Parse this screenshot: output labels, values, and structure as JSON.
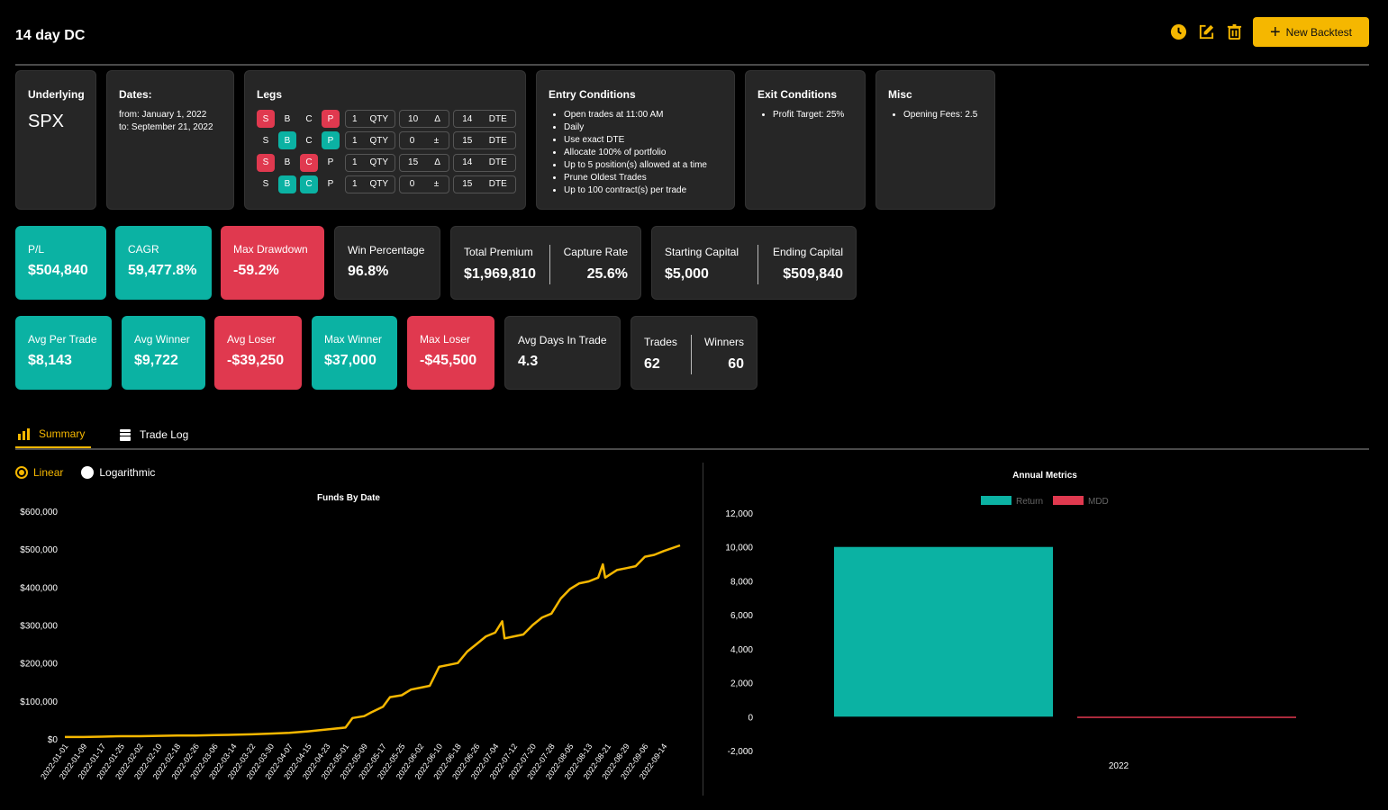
{
  "header": {
    "title": "14 day DC",
    "new_backtest_label": "New Backtest"
  },
  "config": {
    "underlying": {
      "title": "Underlying",
      "value": "SPX"
    },
    "dates": {
      "title": "Dates:",
      "from": "from: January 1, 2022",
      "to": "to: September 21, 2022"
    },
    "legs": {
      "title": "Legs",
      "rows": [
        {
          "s": "S",
          "b": "B",
          "c": "C",
          "p": "P",
          "active": [
            "s",
            "p"
          ],
          "qty": "1",
          "qty_unit": "QTY",
          "delta": "10",
          "delta_sym": "Δ",
          "dte": "14",
          "dte_unit": "DTE"
        },
        {
          "s": "S",
          "b": "B",
          "c": "C",
          "p": "P",
          "active": [
            "b",
            "p"
          ],
          "qty": "1",
          "qty_unit": "QTY",
          "delta": "0",
          "delta_sym": "±",
          "dte": "15",
          "dte_unit": "DTE"
        },
        {
          "s": "S",
          "b": "B",
          "c": "C",
          "p": "P",
          "active": [
            "s",
            "c"
          ],
          "qty": "1",
          "qty_unit": "QTY",
          "delta": "15",
          "delta_sym": "Δ",
          "dte": "14",
          "dte_unit": "DTE"
        },
        {
          "s": "S",
          "b": "B",
          "c": "C",
          "p": "P",
          "active": [
            "b",
            "c"
          ],
          "qty": "1",
          "qty_unit": "QTY",
          "delta": "0",
          "delta_sym": "±",
          "dte": "15",
          "dte_unit": "DTE"
        }
      ]
    },
    "entry": {
      "title": "Entry Conditions",
      "items": [
        "Open trades at 11:00 AM",
        "Daily",
        "Use exact DTE",
        "Allocate 100% of portfolio",
        "Up to 5 position(s) allowed at a time",
        "Prune Oldest Trades",
        "Up to 100 contract(s) per trade"
      ]
    },
    "exit": {
      "title": "Exit Conditions",
      "items": [
        "Profit Target: 25%"
      ]
    },
    "misc": {
      "title": "Misc",
      "items": [
        "Opening Fees: 2.5"
      ]
    }
  },
  "stats_row1": {
    "pl": {
      "label": "P/L",
      "value": "$504,840"
    },
    "cagr": {
      "label": "CAGR",
      "value": "59,477.8%"
    },
    "max_drawdown": {
      "label": "Max Drawdown",
      "value": "-59.2%"
    },
    "win_pct": {
      "label": "Win Percentage",
      "value": "96.8%"
    },
    "total_premium": {
      "label": "Total Premium",
      "value": "$1,969,810"
    },
    "capture_rate": {
      "label": "Capture Rate",
      "value": "25.6%"
    },
    "starting_capital": {
      "label": "Starting Capital",
      "value": "$5,000"
    },
    "ending_capital": {
      "label": "Ending Capital",
      "value": "$509,840"
    }
  },
  "stats_row2": {
    "avg_per_trade": {
      "label": "Avg Per Trade",
      "value": "$8,143"
    },
    "avg_winner": {
      "label": "Avg Winner",
      "value": "$9,722"
    },
    "avg_loser": {
      "label": "Avg Loser",
      "value": "-$39,250"
    },
    "max_winner": {
      "label": "Max Winner",
      "value": "$37,000"
    },
    "max_loser": {
      "label": "Max Loser",
      "value": "-$45,500"
    },
    "avg_days": {
      "label": "Avg Days In Trade",
      "value": "4.3"
    },
    "trades": {
      "label": "Trades",
      "value": "62"
    },
    "winners": {
      "label": "Winners",
      "value": "60"
    }
  },
  "tabs": [
    {
      "label": "Summary",
      "active": true
    },
    {
      "label": "Trade Log",
      "active": false
    }
  ],
  "scale": {
    "linear": "Linear",
    "log": "Logarithmic",
    "selected": "linear"
  },
  "colors": {
    "accent": "#f5b700",
    "teal": "#0bb2a3",
    "red": "#e0394f",
    "card": "#262626"
  },
  "chart_data": [
    {
      "type": "line",
      "title": "Funds By Date",
      "y_ticks": [
        "$0",
        "$100,000",
        "$200,000",
        "$300,000",
        "$400,000",
        "$500,000",
        "$600,000"
      ],
      "ylim": [
        0,
        600000
      ],
      "x_ticks": [
        "2022-01-01",
        "2022-01-09",
        "2022-01-17",
        "2022-01-25",
        "2022-02-02",
        "2022-02-10",
        "2022-02-18",
        "2022-02-26",
        "2022-03-06",
        "2022-03-14",
        "2022-03-22",
        "2022-03-30",
        "2022-04-07",
        "2022-04-15",
        "2022-04-23",
        "2022-05-01",
        "2022-05-09",
        "2022-05-17",
        "2022-05-25",
        "2022-06-02",
        "2022-06-10",
        "2022-06-18",
        "2022-06-26",
        "2022-07-04",
        "2022-07-12",
        "2022-07-20",
        "2022-07-28",
        "2022-08-05",
        "2022-08-13",
        "2022-08-21",
        "2022-08-29",
        "2022-09-06",
        "2022-09-14"
      ],
      "series": [
        {
          "color": "#f5b700",
          "points": [
            [
              "2022-01-01",
              5000
            ],
            [
              "2022-01-09",
              5000
            ],
            [
              "2022-01-17",
              6000
            ],
            [
              "2022-01-25",
              7000
            ],
            [
              "2022-02-02",
              7000
            ],
            [
              "2022-02-10",
              8000
            ],
            [
              "2022-02-18",
              9000
            ],
            [
              "2022-02-26",
              9000
            ],
            [
              "2022-03-06",
              10000
            ],
            [
              "2022-03-14",
              11000
            ],
            [
              "2022-03-22",
              12000
            ],
            [
              "2022-03-30",
              14000
            ],
            [
              "2022-04-07",
              16000
            ],
            [
              "2022-04-15",
              20000
            ],
            [
              "2022-04-23",
              25000
            ],
            [
              "2022-05-01",
              30000
            ],
            [
              "2022-05-04",
              55000
            ],
            [
              "2022-05-09",
              60000
            ],
            [
              "2022-05-12",
              70000
            ],
            [
              "2022-05-17",
              85000
            ],
            [
              "2022-05-20",
              110000
            ],
            [
              "2022-05-25",
              115000
            ],
            [
              "2022-05-29",
              130000
            ],
            [
              "2022-06-02",
              135000
            ],
            [
              "2022-06-06",
              140000
            ],
            [
              "2022-06-10",
              190000
            ],
            [
              "2022-06-14",
              195000
            ],
            [
              "2022-06-18",
              200000
            ],
            [
              "2022-06-22",
              230000
            ],
            [
              "2022-06-26",
              250000
            ],
            [
              "2022-06-30",
              270000
            ],
            [
              "2022-07-04",
              280000
            ],
            [
              "2022-07-07",
              310000
            ],
            [
              "2022-07-08",
              265000
            ],
            [
              "2022-07-12",
              270000
            ],
            [
              "2022-07-16",
              275000
            ],
            [
              "2022-07-20",
              300000
            ],
            [
              "2022-07-24",
              320000
            ],
            [
              "2022-07-28",
              330000
            ],
            [
              "2022-08-01",
              370000
            ],
            [
              "2022-08-05",
              395000
            ],
            [
              "2022-08-09",
              410000
            ],
            [
              "2022-08-13",
              415000
            ],
            [
              "2022-08-17",
              425000
            ],
            [
              "2022-08-19",
              460000
            ],
            [
              "2022-08-20",
              425000
            ],
            [
              "2022-08-25",
              445000
            ],
            [
              "2022-08-29",
              450000
            ],
            [
              "2022-09-02",
              455000
            ],
            [
              "2022-09-06",
              480000
            ],
            [
              "2022-09-10",
              485000
            ],
            [
              "2022-09-14",
              495000
            ],
            [
              "2022-09-21",
              509840
            ]
          ]
        }
      ]
    },
    {
      "type": "bar",
      "title": "Annual Metrics",
      "categories": [
        "2022"
      ],
      "y_ticks": [
        "-2,000",
        "0",
        "2,000",
        "4,000",
        "6,000",
        "8,000",
        "10,000",
        "12,000"
      ],
      "ylim": [
        -2000,
        12000
      ],
      "legend": "top",
      "series": [
        {
          "name": "Return",
          "color": "#0bb2a3",
          "values": [
            10000
          ]
        },
        {
          "name": "MDD",
          "color": "#e0394f",
          "values": [
            -59
          ]
        }
      ]
    }
  ]
}
